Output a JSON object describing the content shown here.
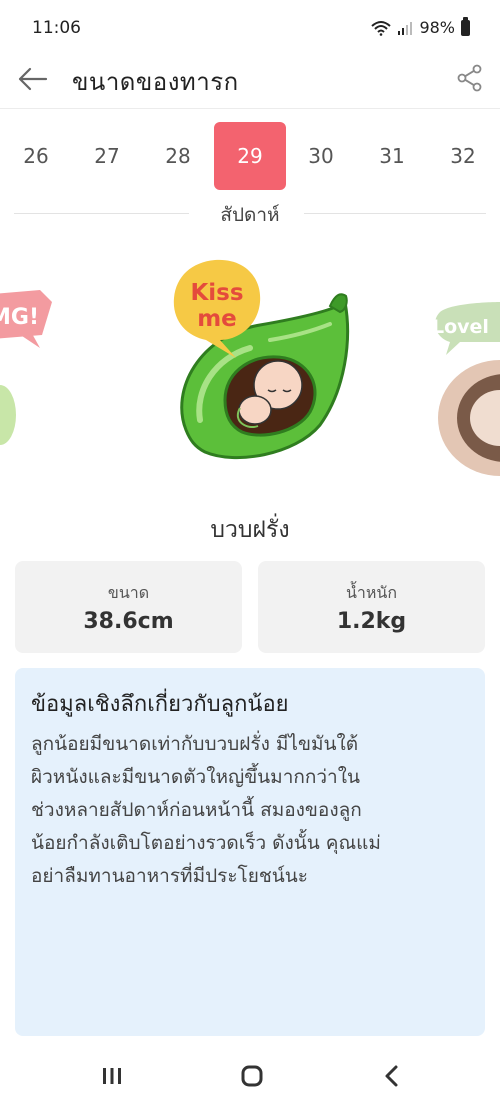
{
  "status_bar": {
    "time": "11:06",
    "battery": "98%",
    "icons": [
      "wifi-icon",
      "signal-icon",
      "battery-icon"
    ]
  },
  "header": {
    "title": "ขนาดของทารก",
    "back_icon": "arrow-left-icon",
    "share_icon": "share-icon"
  },
  "week_selector": {
    "weeks": [
      "26",
      "27",
      "28",
      "29",
      "30",
      "31",
      "32"
    ],
    "selected": "29",
    "label": "สัปดาห์",
    "accent_color": "#f3636f"
  },
  "carousel": {
    "left_bubble": "MG!",
    "center_bubble_line1": "Kiss",
    "center_bubble_line2": "me",
    "right_bubble": "Lovel"
  },
  "fruit": {
    "name": "บวบฝรั่ง"
  },
  "stats": {
    "size_label": "ขนาด",
    "size_value": "38.6cm",
    "weight_label": "น้ำหนัก",
    "weight_value": "1.2kg"
  },
  "insight": {
    "title": "ข้อมูลเชิงลึกเกี่ยวกับลูกน้อย",
    "lines": [
      "ลูกน้อยมีขนาดเท่ากับบวบฝรั่ง มีไขมันใต้",
      "ผิวหนังและมีขนาดตัวใหญ่ขึ้นมากกว่าใน",
      "ช่วงหลายสัปดาห์ก่อนหน้านี้ สมองของลูก",
      "น้อยกำลังเติบโตอย่างรวดเร็ว ดังนั้น คุณแม่",
      "อย่าลืมทานอาหารที่มีประโยชน์นะ"
    ],
    "background": "#e5f1fc"
  },
  "nav": {
    "icons": [
      "recent-apps-icon",
      "home-icon",
      "back-icon"
    ]
  }
}
